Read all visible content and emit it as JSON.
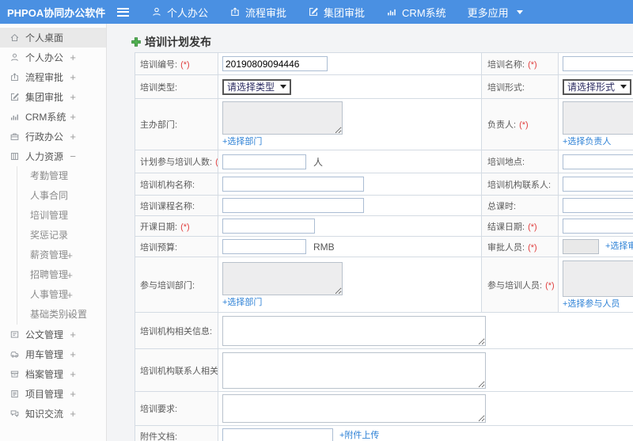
{
  "header": {
    "brand": "PHPOA协同办公软件",
    "nav": [
      {
        "label": "个人办公",
        "icon": "user-icon"
      },
      {
        "label": "流程审批",
        "icon": "process-icon"
      },
      {
        "label": "集团审批",
        "icon": "edit-icon"
      },
      {
        "label": "CRM系统",
        "icon": "chart-icon"
      },
      {
        "label": "更多应用",
        "icon": "caret-down-icon"
      }
    ]
  },
  "sidebar": {
    "items": [
      {
        "label": "个人桌面",
        "icon": "home-icon",
        "expand": "",
        "active": true
      },
      {
        "label": "个人办公",
        "icon": "user-icon",
        "expand": "+"
      },
      {
        "label": "流程审批",
        "icon": "process-icon",
        "expand": "+"
      },
      {
        "label": "集团审批",
        "icon": "edit-icon",
        "expand": "+"
      },
      {
        "label": "CRM系统",
        "icon": "chart-icon",
        "expand": "+"
      },
      {
        "label": "行政办公",
        "icon": "briefcase-icon",
        "expand": "+"
      },
      {
        "label": "人力资源",
        "icon": "book-icon",
        "expand": "−",
        "children": [
          {
            "label": "考勤管理",
            "expand": ""
          },
          {
            "label": "人事合同",
            "expand": ""
          },
          {
            "label": "培训管理",
            "expand": ""
          },
          {
            "label": "奖惩记录",
            "expand": ""
          },
          {
            "label": "薪资管理",
            "expand": "+"
          },
          {
            "label": "招聘管理",
            "expand": "+"
          },
          {
            "label": "人事管理",
            "expand": "+"
          },
          {
            "label": "基础类别设置",
            "expand": "+"
          }
        ]
      },
      {
        "label": "公文管理",
        "icon": "document-icon",
        "expand": "+"
      },
      {
        "label": "用车管理",
        "icon": "car-icon",
        "expand": "+"
      },
      {
        "label": "档案管理",
        "icon": "archive-icon",
        "expand": "+"
      },
      {
        "label": "项目管理",
        "icon": "clipboard-icon",
        "expand": "+"
      },
      {
        "label": "知识交流",
        "icon": "chat-icon",
        "expand": "+"
      }
    ]
  },
  "main": {
    "title": "培训计划发布",
    "title_icon": "plus-icon",
    "form": {
      "required_mark": "(*)",
      "fields": {
        "training_no": {
          "label": "培训编号:",
          "value": "20190809094446"
        },
        "training_name": {
          "label": "培训名称:"
        },
        "training_type": {
          "label": "培训类型:",
          "select": "请选择类型"
        },
        "training_form": {
          "label": "培训形式:",
          "select": "请选择形式"
        },
        "host_dept": {
          "label": "主办部门:",
          "link": "+选择部门"
        },
        "leader": {
          "label": "负责人:",
          "link": "+选择负责人"
        },
        "planned_count": {
          "label": "计划参与培训人数:",
          "suffix": "人"
        },
        "location": {
          "label": "培训地点:"
        },
        "org_name": {
          "label": "培训机构名称:"
        },
        "org_contact": {
          "label": "培训机构联系人:"
        },
        "course_name": {
          "label": "培训课程名称:"
        },
        "total_hours": {
          "label": "总课时:"
        },
        "start_date": {
          "label": "开课日期:"
        },
        "end_date": {
          "label": "结课日期:"
        },
        "budget": {
          "label": "培训预算:",
          "suffix": "RMB"
        },
        "approver": {
          "label": "审批人员:",
          "link": "+选择审批人员"
        },
        "join_dept": {
          "label": "参与培训部门:",
          "link": "+选择部门"
        },
        "join_people": {
          "label": "参与培训人员:",
          "link": "+选择参与人员"
        },
        "org_info": {
          "label": "培训机构相关信息:"
        },
        "org_contact_info": {
          "label": "培训机构联系人相关信息:"
        },
        "requirements": {
          "label": "培训要求:"
        },
        "attachment": {
          "label": "附件文档:",
          "link": "+附件上传"
        }
      }
    }
  },
  "colors": {
    "header_bg": "#4a90e2",
    "link": "#2f82d6",
    "required": "#e04040",
    "title_plus_green": "#52b152",
    "table_border": "#d4dbe3"
  }
}
